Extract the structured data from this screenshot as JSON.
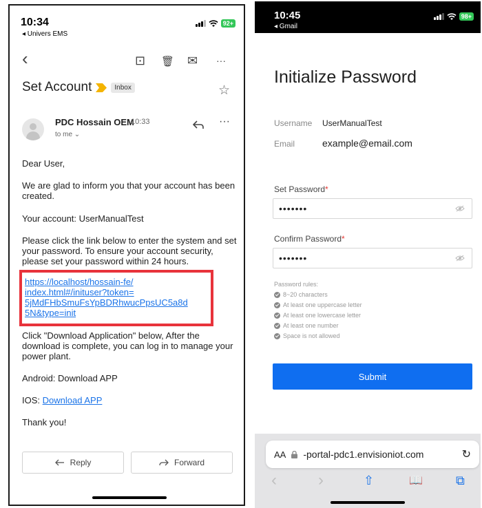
{
  "gmail": {
    "status": {
      "time": "10:34",
      "back_app": "◂ Univers EMS",
      "battery": "92+"
    },
    "toolbar": {
      "back": "‹",
      "archive": "⊡",
      "delete": "🗑",
      "mail": "✉",
      "more": "···"
    },
    "subject": "Set Account",
    "label": "Inbox",
    "star": "☆",
    "sender": "PDC Hossain OEM",
    "sender_time": "10:33",
    "to": "to me ⌄",
    "more": "···",
    "body": {
      "greeting": "Dear User,",
      "p1": "We are glad to inform you that your account has been created.",
      "account": "Your account: UserManualTest",
      "p2": "Please click the link below to enter the system and set your password. To ensure your account security, please set your password within 24 hours.",
      "link_line1": "https://localhost/hossain-fe/",
      "link_line2": "index.html#/inituser?token=",
      "link_line3": "5jMdFHbSmuFsYpBDRhwucPpsUC5a8d",
      "link_line4": "5N&type=init",
      "p3": "Click \"Download Application\" below, After the download is complete, you can log in to manage your power plant.",
      "android": "Android: Download APP",
      "ios_label": "IOS:",
      "ios_link": "Download APP",
      "thanks": "Thank you!"
    },
    "buttons": {
      "reply": "Reply",
      "forward": "Forward"
    }
  },
  "portal": {
    "status": {
      "time": "10:45",
      "back_app": "◂ Gmail",
      "battery": "98+"
    },
    "title": "Initialize Password",
    "username_label": "Username",
    "username_value": "UserManualTest",
    "email_label": "Email",
    "email_value": "example@email.com",
    "set_password_label": "Set Password",
    "set_password_value": "•••••••",
    "confirm_password_label": "Confirm Password",
    "confirm_password_value": "•••••••",
    "required_mark": "*",
    "rules_title": "Password rules:",
    "rules": [
      "8~20 characters",
      "At least one uppercase letter",
      "At least one lowercase letter",
      "At least one number",
      "Space is not allowed"
    ],
    "submit": "Submit"
  },
  "safari": {
    "aa": "AA",
    "url": "-portal-pdc1.envisioniot.com",
    "reload": "↻",
    "nav": {
      "back": "‹",
      "forward": "›",
      "share": "⇧",
      "bookmarks": "📖",
      "tabs": "⧉"
    }
  }
}
